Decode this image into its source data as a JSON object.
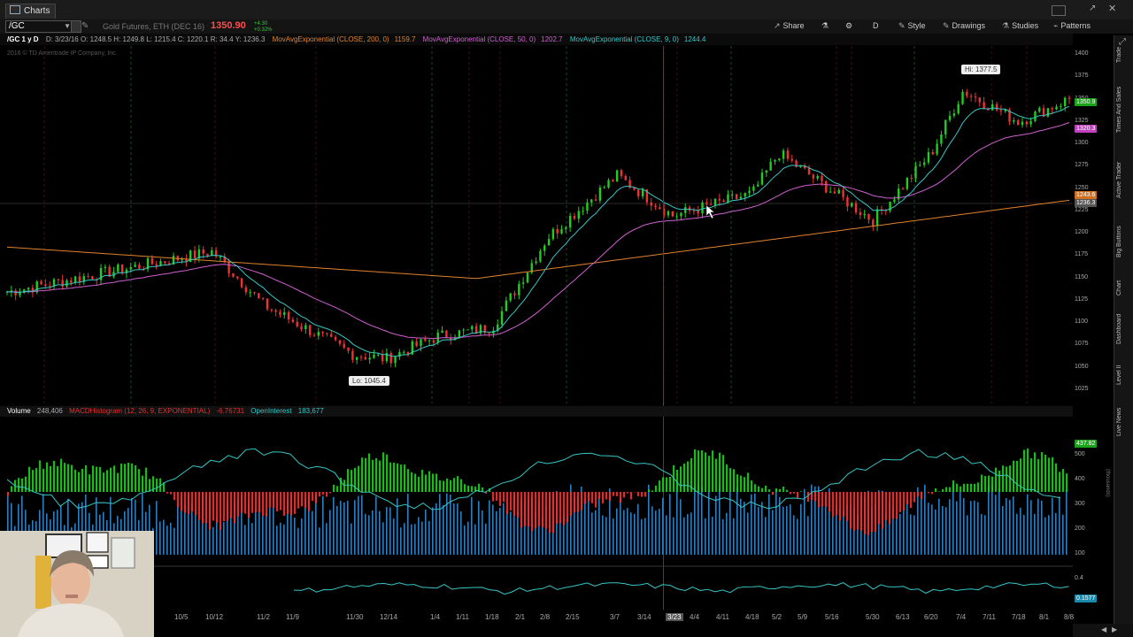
{
  "window": {
    "tab_title": "Charts"
  },
  "toolbar": {
    "symbol": "/GC",
    "description": "Gold Futures, ETH (DEC 16)",
    "last_price": "1350.90",
    "change": "+4.30",
    "change_pct": "+0.32%",
    "buttons": {
      "share": "Share",
      "timeframe": "D",
      "style": "Style",
      "drawings": "Drawings",
      "studies": "Studies",
      "patterns": "Patterns"
    }
  },
  "studybar": {
    "period": "/GC 1 y D",
    "ohlc": "D: 3/23/16  O: 1248.5  H: 1249.8  L: 1215.4  C: 1220.1  R: 34.4  Y: 1236.3",
    "ma200": "MovAvgExponential (CLOSE, 200, 0)",
    "ma200_val": "1159.7",
    "ma50": "MovAvgExponential (CLOSE, 50, 0)",
    "ma50_val": "1202.7",
    "ma9": "MovAvgExponential (CLOSE, 9, 0)",
    "ma9_val": "1244.4"
  },
  "copyright": "2016 © TD Ameritrade IP Company, Inc.",
  "price_axis": [
    "1400",
    "1375",
    "1350",
    "1325",
    "1300",
    "1275",
    "1250",
    "1225",
    "1200",
    "1175",
    "1150",
    "1125",
    "1100",
    "1075",
    "1050",
    "1025"
  ],
  "price_tags": {
    "last": "1350.9",
    "ma9": "1320.3",
    "ma50": "1243.6",
    "y": "1236.3"
  },
  "annotations": {
    "high": "Hi: 1377.5",
    "low": "Lo: 1045.4"
  },
  "lower": {
    "volume_label": "Volume",
    "volume_val": "248,406",
    "macd_label": "MACDHistogram (12, 26, 9, EXPONENTIAL)",
    "macd_val": "-6.76731",
    "oi_label": "OpenInterest",
    "oi_val": "183,677",
    "axis": [
      "500",
      "400",
      "300",
      "200",
      "100"
    ],
    "tag": "437.82",
    "units": "(thousands)"
  },
  "bottom_panel": {
    "axis": "0.4",
    "tag": "0.1577"
  },
  "x_axis": [
    "10/5",
    "10/12",
    "11/2",
    "11/9",
    "11/30",
    "12/14",
    "1/4",
    "1/11",
    "1/18",
    "2/1",
    "2/8",
    "2/15",
    "3/7",
    "3/14",
    "3/23",
    "4/4",
    "4/11",
    "4/18",
    "5/2",
    "5/9",
    "5/16",
    "5/30",
    "6/13",
    "6/20",
    "7/4",
    "7/11",
    "7/18",
    "8/1",
    "8/8"
  ],
  "sidebar": [
    "Trade",
    "Times And Sales",
    "Active Trader",
    "Big Buttons",
    "Chart",
    "Dashboard",
    "Level II",
    "Live News"
  ],
  "colors": {
    "ma200": "#e0822c",
    "ma50": "#d060d0",
    "ma9": "#36c6c6",
    "up": "#22cc22",
    "down": "#ee3333",
    "volume": "#2b7fc0"
  },
  "chart_data": {
    "type": "candlestick",
    "symbol": "/GC",
    "ylim": [
      1010,
      1410
    ],
    "key_points": [
      {
        "x": "10/5",
        "close": 1135
      },
      {
        "x": "10/12",
        "close": 1180
      },
      {
        "x": "11/2",
        "close": 1120
      },
      {
        "x": "11/30",
        "close": 1065
      },
      {
        "x": "12/14",
        "close": 1060
      },
      {
        "x": "1/4",
        "close": 1085
      },
      {
        "x": "1/18",
        "close": 1095
      },
      {
        "x": "2/8",
        "close": 1195
      },
      {
        "x": "3/7",
        "close": 1265
      },
      {
        "x": "3/23",
        "close": 1220
      },
      {
        "x": "4/18",
        "close": 1245
      },
      {
        "x": "5/2",
        "close": 1290
      },
      {
        "x": "5/30",
        "close": 1215
      },
      {
        "x": "6/20",
        "close": 1290
      },
      {
        "x": "7/4",
        "close": 1360
      },
      {
        "x": "7/18",
        "close": 1325
      },
      {
        "x": "8/8",
        "close": 1350.9
      }
    ]
  }
}
